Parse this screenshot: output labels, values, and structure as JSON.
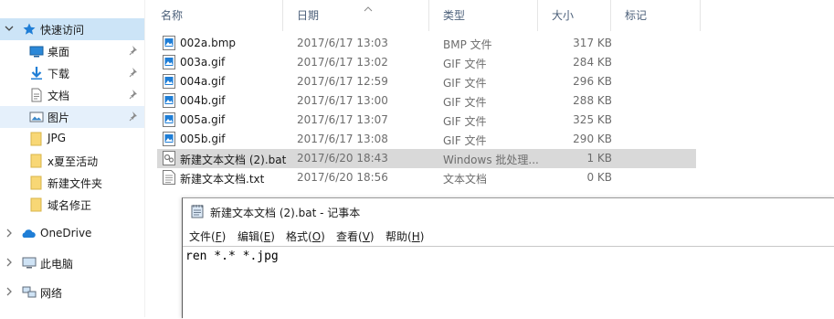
{
  "sidebar": {
    "quick_access": "快速访问",
    "items": [
      {
        "label": "桌面",
        "icon": "desktop-icon",
        "pinned": true
      },
      {
        "label": "下载",
        "icon": "download-icon",
        "pinned": true
      },
      {
        "label": "文档",
        "icon": "document-icon",
        "pinned": true
      },
      {
        "label": "图片",
        "icon": "picture-icon",
        "pinned": true
      },
      {
        "label": "JPG",
        "icon": "folder-icon",
        "pinned": false
      },
      {
        "label": "x夏至活动",
        "icon": "folder-icon",
        "pinned": false
      },
      {
        "label": "新建文件夹",
        "icon": "folder-icon",
        "pinned": false
      },
      {
        "label": "域名修正",
        "icon": "folder-icon",
        "pinned": false
      }
    ],
    "onedrive": "OneDrive",
    "this_pc": "此电脑",
    "network": "网络"
  },
  "columns": {
    "name": "名称",
    "date": "日期",
    "type": "类型",
    "size": "大小",
    "tags": "标记"
  },
  "files": [
    {
      "name": "002a.bmp",
      "date": "2017/6/17 13:03",
      "type": "BMP 文件",
      "size": "317 KB",
      "icon": "image-file-icon"
    },
    {
      "name": "003a.gif",
      "date": "2017/6/17 13:02",
      "type": "GIF 文件",
      "size": "284 KB",
      "icon": "image-file-icon"
    },
    {
      "name": "004a.gif",
      "date": "2017/6/17 12:59",
      "type": "GIF 文件",
      "size": "296 KB",
      "icon": "image-file-icon"
    },
    {
      "name": "004b.gif",
      "date": "2017/6/17 13:00",
      "type": "GIF 文件",
      "size": "288 KB",
      "icon": "image-file-icon"
    },
    {
      "name": "005a.gif",
      "date": "2017/6/17 13:07",
      "type": "GIF 文件",
      "size": "325 KB",
      "icon": "image-file-icon"
    },
    {
      "name": "005b.gif",
      "date": "2017/6/17 13:08",
      "type": "GIF 文件",
      "size": "290 KB",
      "icon": "image-file-icon"
    },
    {
      "name": "新建文本文档 (2).bat",
      "date": "2017/6/20 18:43",
      "type": "Windows 批处理...",
      "size": "1 KB",
      "icon": "batch-file-icon",
      "selected": true
    },
    {
      "name": "新建文本文档.txt",
      "date": "2017/6/20 18:56",
      "type": "文本文档",
      "size": "0 KB",
      "icon": "text-file-icon"
    }
  ],
  "notepad": {
    "title": "新建文本文档 (2).bat - 记事本",
    "menus": [
      {
        "label": "文件(",
        "key": "F",
        "end": ")"
      },
      {
        "label": "编辑(",
        "key": "E",
        "end": ")"
      },
      {
        "label": "格式(",
        "key": "O",
        "end": ")"
      },
      {
        "label": "查看(",
        "key": "V",
        "end": ")"
      },
      {
        "label": "帮助(",
        "key": "H",
        "end": ")"
      }
    ],
    "content": "ren *.* *.jpg"
  }
}
